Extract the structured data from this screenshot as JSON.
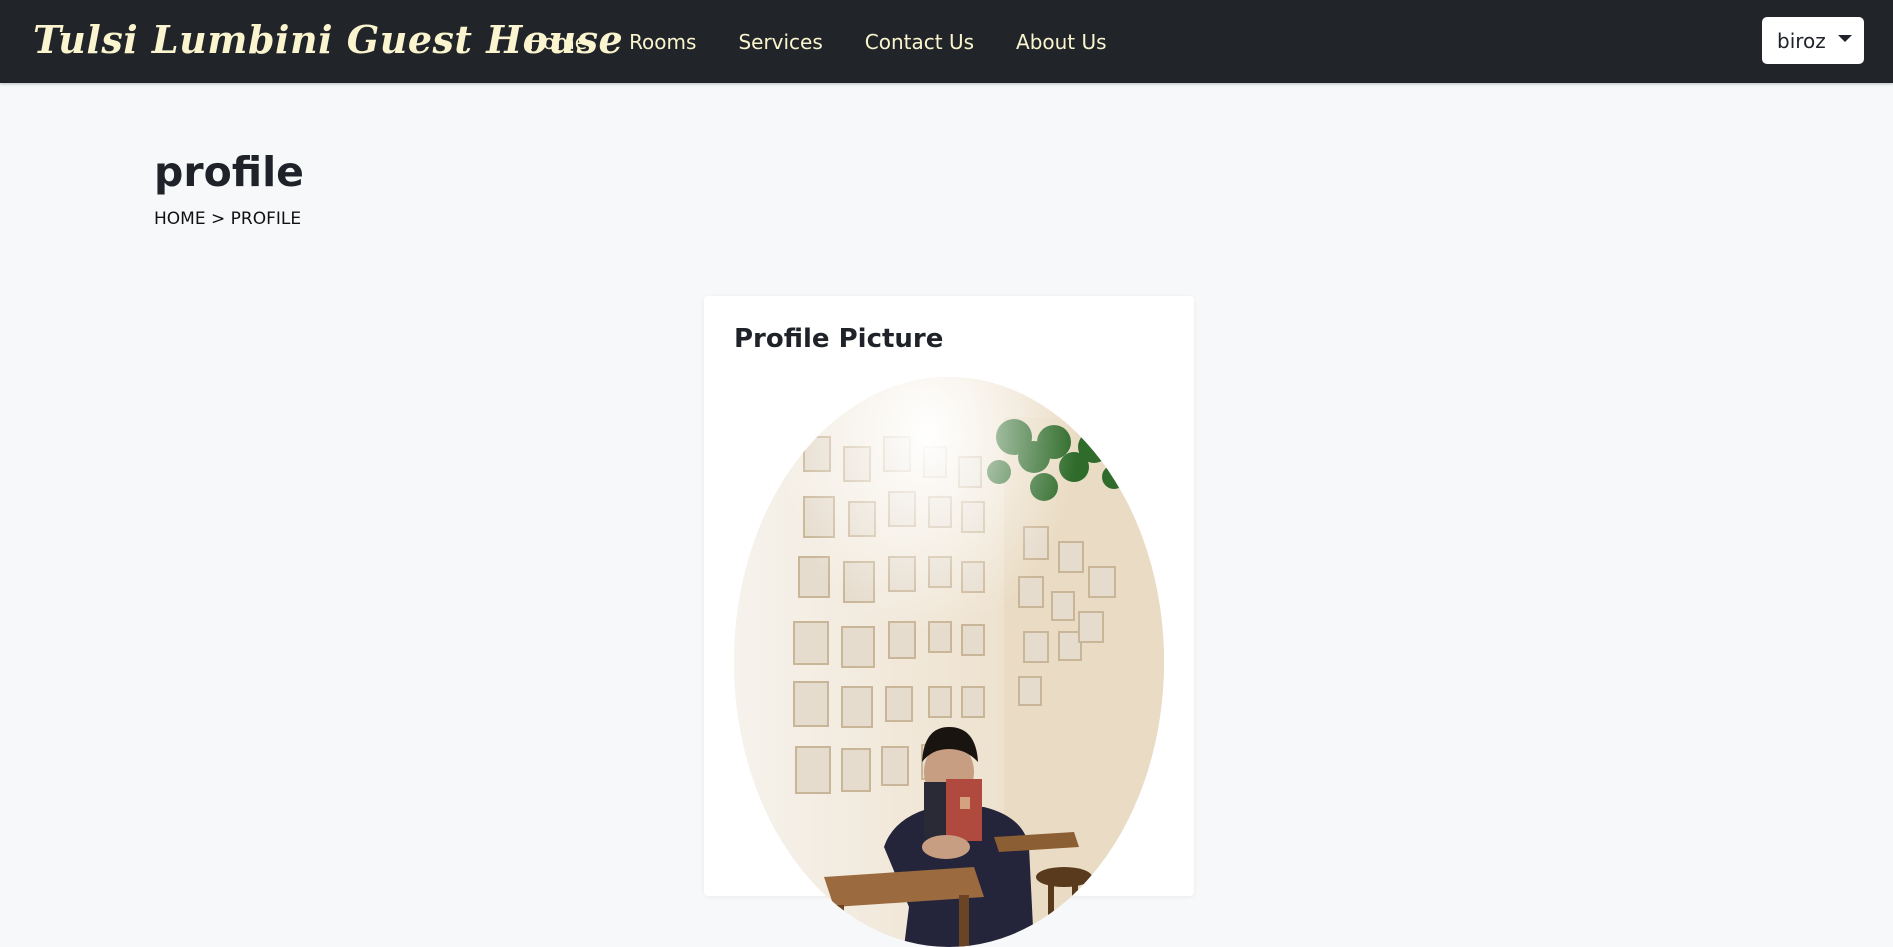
{
  "navbar": {
    "brand": "Tulsi Lumbini Guest House",
    "links": [
      {
        "label": "Home"
      },
      {
        "label": "Rooms"
      },
      {
        "label": "Services"
      },
      {
        "label": "Contact Us"
      },
      {
        "label": "About Us"
      }
    ],
    "user": {
      "name": "biroz"
    }
  },
  "page": {
    "title": "profile",
    "breadcrumb": {
      "home": "HOME",
      "separator": ">",
      "current": "PROFILE"
    }
  },
  "profile_card": {
    "title": "Profile Picture",
    "picture_alt": "Profile picture: person holding a book in a cafe corner with framed photos on the wall"
  },
  "colors": {
    "navbar_bg": "#212529",
    "brand_text": "#fbf5cf",
    "page_bg": "#f7f8fa",
    "card_bg": "#ffffff"
  }
}
